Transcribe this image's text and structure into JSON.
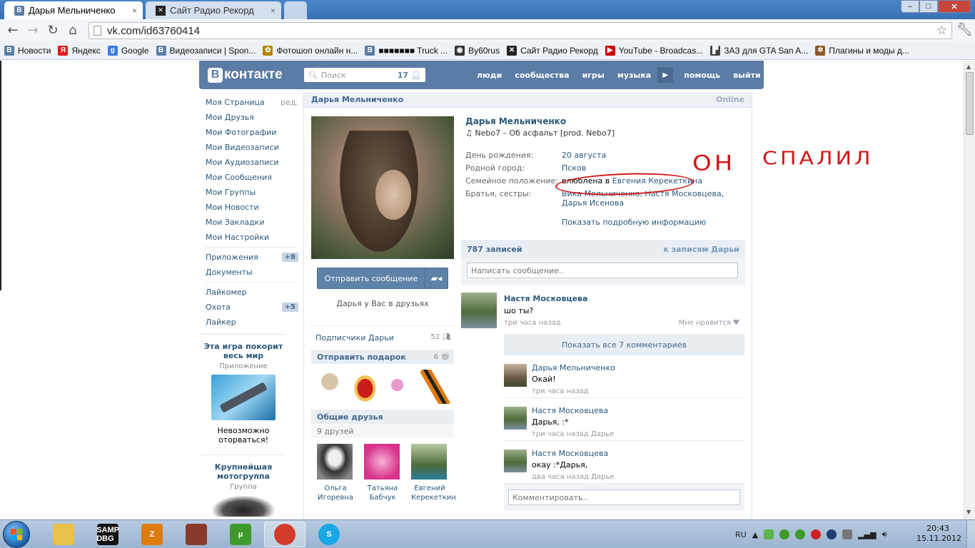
{
  "browser": {
    "tabs": [
      {
        "title": "Дарья Мельниченко",
        "favicon": "vk-icon",
        "close": "×"
      },
      {
        "title": "Сайт Радио Рекорд",
        "favicon": "radio-record-icon",
        "close": "×"
      }
    ],
    "window_controls": {
      "minimize": "‒",
      "maximize": "□",
      "close": "✕"
    },
    "url": "vk.com/id63760414",
    "bookmarks": [
      {
        "label": "Новости",
        "icon": "vk-icon",
        "color": "#5b7fa6",
        "glyph": "В"
      },
      {
        "label": "Яндекс",
        "icon": "yandex-icon",
        "color": "#e21d1d",
        "glyph": "Я"
      },
      {
        "label": "Google",
        "icon": "google-icon",
        "color": "#3a7be0",
        "glyph": "g"
      },
      {
        "label": "Видеозаписи | Spon...",
        "icon": "vk-icon",
        "color": "#5b7fa6",
        "glyph": "В"
      },
      {
        "label": "Фотошоп онлайн н...",
        "icon": "photoshop-icon",
        "color": "#b8860b",
        "glyph": "✿"
      },
      {
        "label": "■■■■■■■ Truck ...",
        "icon": "vk-icon",
        "color": "#5b7fa6",
        "glyph": "В"
      },
      {
        "label": "By60rus",
        "icon": "by60rus-icon",
        "color": "#333333",
        "glyph": "◉"
      },
      {
        "label": "Сайт Радио Рекорд",
        "icon": "radio-record-icon",
        "color": "#222222",
        "glyph": "✕"
      },
      {
        "label": "YouTube - Broadcas...",
        "icon": "youtube-icon",
        "color": "#cc0000",
        "glyph": "▶"
      },
      {
        "label": "ЗАЗ для GTA San A...",
        "icon": "gta-icon",
        "color": "#444444",
        "glyph": "▛"
      },
      {
        "label": "Плагины и моды д...",
        "icon": "plugins-icon",
        "color": "#8b5a2b",
        "glyph": "✲"
      }
    ]
  },
  "vk": {
    "logo": "контакте",
    "logo_letter": "В",
    "search": {
      "placeholder": "Поиск",
      "count": "17"
    },
    "nav": [
      "люди",
      "сообщества",
      "игры",
      "музыка",
      "помощь",
      "выйти"
    ],
    "menu": [
      {
        "label": "Моя Страница",
        "extra": "ред."
      },
      {
        "label": "Мои Друзья"
      },
      {
        "label": "Мои Фотографии"
      },
      {
        "label": "Мои Видеозаписи"
      },
      {
        "label": "Мои Аудиозаписи"
      },
      {
        "label": "Мои Сообщения"
      },
      {
        "label": "Мои Группы"
      },
      {
        "label": "Мои Новости"
      },
      {
        "label": "Мои Закладки"
      },
      {
        "label": "Мои Настройки"
      }
    ],
    "menu2": [
      {
        "label": "Приложения",
        "badge": "+8"
      },
      {
        "label": "Документы"
      }
    ],
    "menu3": [
      {
        "label": "Лайкомер"
      },
      {
        "label": "Охота",
        "badge": "+5"
      },
      {
        "label": "Лайкер"
      }
    ],
    "ads": [
      {
        "title": "Эта игра покорит весь мир",
        "sub": "Приложение",
        "text": "Невозможно оторваться!"
      },
      {
        "title": "Крупнейшая мотогруппа",
        "sub": "Группа"
      }
    ],
    "page_head": {
      "name": "Дарья Мельниченко",
      "status": "Online"
    },
    "profile": {
      "name": "Дарья Мельниченко",
      "music": "♫ Nebo7 – Об асфальт [prod. Nebo7]",
      "send_button": "Отправить сообщение",
      "friend_note": "Дарья у Вас в друзьях",
      "subscribers": {
        "label": "Подписчики Дарьи",
        "count": "52"
      },
      "gifts": {
        "label": "Отправить подарок",
        "count": "6"
      },
      "common_friends": {
        "label": "Общие друзья",
        "count": "9 друзей"
      },
      "friends": [
        {
          "first": "Ольга",
          "last": "Игоревна"
        },
        {
          "first": "Татьяна",
          "last": "Бабчук"
        },
        {
          "first": "Евгений",
          "last": "Керекеткин"
        }
      ],
      "info": {
        "birthday_label": "День рождения:",
        "birthday": "20 августа",
        "city_label": "Родной город:",
        "city": "Псков",
        "relation_label": "Семейное положение:",
        "relation_prefix": "влюблена в ",
        "relation_partner": "Евгения Керекеткина",
        "siblings_label": "Братья, сестры:",
        "siblings": "Вика Мельниченко, Настя Московцева, Дарья Исенова",
        "more": "Показать подробную информацию"
      }
    },
    "wall": {
      "count": "787 записей",
      "link": "к записям Дарьи",
      "placeholder": "Написать сообщение..",
      "post": {
        "author": "Настя Московцева",
        "text": "шо ты?",
        "time": "три часа назад",
        "like": "Мне нравится ♥"
      },
      "show_all": "Показать все 7 комментариев",
      "replies": [
        {
          "author": "Дарья Мельниченко",
          "text": "Окай!",
          "time": "три часа назад"
        },
        {
          "author": "Настя Московцева",
          "text": "Дарья, :*",
          "time": "три часа назад Дарье"
        },
        {
          "author": "Настя Московцева",
          "text": "окау :*Дарья,",
          "time": "два часа назад Дарье"
        }
      ],
      "comment_placeholder": "Комментировать.."
    },
    "annotations": {
      "one": "ОН",
      "two": "СПАЛИЛ"
    }
  },
  "taskbar": {
    "apps": [
      {
        "name": "explorer",
        "label": "",
        "color": "#e8c04a"
      },
      {
        "name": "samp",
        "label": "SAMP DBG",
        "color": "#111111"
      },
      {
        "name": "zona",
        "label": "Z",
        "color": "#e07b12"
      },
      {
        "name": "game",
        "label": "",
        "color": "#8a3a2a"
      },
      {
        "name": "utorrent",
        "label": "µ",
        "color": "#3d9a2b"
      },
      {
        "name": "chrome",
        "label": "",
        "color": "#d23b2a"
      },
      {
        "name": "skype",
        "label": "S",
        "color": "#19a7e6"
      }
    ],
    "lang": "RU",
    "time": "20:43",
    "date": "15.11.2012"
  }
}
